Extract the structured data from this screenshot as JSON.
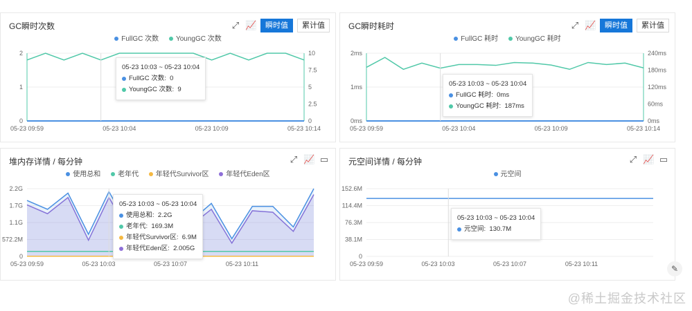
{
  "panels": {
    "gc_count": {
      "title": "GC瞬时次数",
      "btn_instant": "瞬时值",
      "btn_cumulative": "累计值",
      "legend": [
        {
          "label": "FullGC 次数",
          "color": "#4a90e2"
        },
        {
          "label": "YoungGC 次数",
          "color": "#50c8a8"
        }
      ],
      "tooltip": {
        "range": "05-23 10:03 ~ 05-23 10:04",
        "rows": [
          {
            "label": "FullGC 次数:",
            "value": "0",
            "color": "#4a90e2"
          },
          {
            "label": "YoungGC 次数:",
            "value": "9",
            "color": "#50c8a8"
          }
        ]
      }
    },
    "gc_time": {
      "title": "GC瞬时耗时",
      "btn_instant": "瞬时值",
      "btn_cumulative": "累计值",
      "legend": [
        {
          "label": "FullGC 耗时",
          "color": "#4a90e2"
        },
        {
          "label": "YoungGC 耗时",
          "color": "#50c8a8"
        }
      ],
      "tooltip": {
        "range": "05-23 10:03 ~ 05-23 10:04",
        "rows": [
          {
            "label": "FullGC 耗时:",
            "value": "0ms",
            "color": "#4a90e2"
          },
          {
            "label": "YoungGC 耗时:",
            "value": "187ms",
            "color": "#50c8a8"
          }
        ]
      }
    },
    "heap": {
      "title": "堆内存详情 / 每分钟",
      "legend": [
        {
          "label": "使用总和",
          "color": "#4a90e2"
        },
        {
          "label": "老年代",
          "color": "#50c8a8"
        },
        {
          "label": "年轻代Survivor区",
          "color": "#f5b942"
        },
        {
          "label": "年轻代Eden区",
          "color": "#8e6fd8"
        }
      ],
      "tooltip": {
        "range": "05-23 10:03 ~ 05-23 10:04",
        "rows": [
          {
            "label": "使用总和:",
            "value": "2.2G",
            "color": "#4a90e2"
          },
          {
            "label": "老年代:",
            "value": "169.3M",
            "color": "#50c8a8"
          },
          {
            "label": "年轻代Survivor区:",
            "value": "6.9M",
            "color": "#f5b942"
          },
          {
            "label": "年轻代Eden区:",
            "value": "2.005G",
            "color": "#8e6fd8"
          }
        ]
      }
    },
    "meta": {
      "title": "元空间详情 / 每分钟",
      "legend": [
        {
          "label": "元空间",
          "color": "#4a90e2"
        }
      ],
      "tooltip": {
        "range": "05-23 10:03 ~ 05-23 10:04",
        "rows": [
          {
            "label": "元空间:",
            "value": "130.7M",
            "color": "#4a90e2"
          }
        ]
      }
    }
  },
  "icons": {
    "expand": "expand-icon",
    "line_chart": "line-chart-icon",
    "table": "table-icon",
    "edit": "edit-icon"
  },
  "brand": "@稀土掘金技术社区",
  "chart_data": [
    {
      "type": "line",
      "title": "GC瞬时次数",
      "x_ticks": [
        "05-23 09:59",
        "05-23 10:04",
        "05-23 10:09",
        "05-23 10:14"
      ],
      "y_left_ticks": [
        "0",
        "1",
        "2"
      ],
      "y_right_ticks": [
        "0",
        "2.5",
        "5",
        "7.5",
        "10"
      ],
      "ylim_left": [
        0,
        2
      ],
      "ylim_right": [
        0,
        10
      ],
      "series": [
        {
          "name": "FullGC 次数",
          "axis": "left",
          "values": [
            0,
            0,
            0,
            0,
            0,
            0,
            0,
            0,
            0,
            0,
            0,
            0,
            0,
            0,
            0,
            0
          ]
        },
        {
          "name": "YoungGC 次数",
          "axis": "right",
          "values": [
            9,
            10,
            9,
            10,
            9,
            10,
            10,
            10,
            10,
            10,
            9,
            10,
            9,
            10,
            10,
            9
          ]
        }
      ]
    },
    {
      "type": "line",
      "title": "GC瞬时耗时",
      "x_ticks": [
        "05-23 09:59",
        "05-23 10:04",
        "05-23 10:09",
        "05-23 10:14"
      ],
      "y_left_ticks": [
        "0ms",
        "1ms",
        "2ms"
      ],
      "y_right_ticks": [
        "0ms",
        "60ms",
        "120ms",
        "180ms",
        "240ms"
      ],
      "ylim_left": [
        0,
        2
      ],
      "ylim_right": [
        0,
        240
      ],
      "series": [
        {
          "name": "FullGC 耗时",
          "axis": "left",
          "values": [
            0,
            0,
            0,
            0,
            0,
            0,
            0,
            0,
            0,
            0,
            0,
            0,
            0,
            0,
            0,
            0
          ]
        },
        {
          "name": "YoungGC 耗时",
          "axis": "right",
          "values": [
            190,
            225,
            183,
            205,
            187,
            200,
            200,
            197,
            207,
            205,
            198,
            183,
            207,
            200,
            205,
            188
          ]
        }
      ]
    },
    {
      "type": "area",
      "title": "堆内存详情 / 每分钟",
      "x_ticks": [
        "05-23 09:59",
        "05-23 10:03",
        "05-23 10:07",
        "05-23 10:11"
      ],
      "y_ticks": [
        "0",
        "572.2M",
        "1.1G",
        "1.7G",
        "2.2G"
      ],
      "ylim": [
        0,
        2.3
      ],
      "series": [
        {
          "name": "使用总和",
          "values": [
            1.9,
            1.6,
            2.15,
            0.75,
            2.2,
            0.95,
            1.5,
            1.9,
            1.2,
            1.8,
            0.6,
            1.7,
            1.7,
            1.0,
            2.3
          ]
        },
        {
          "name": "老年代",
          "values": [
            0.17,
            0.17,
            0.17,
            0.17,
            0.17,
            0.17,
            0.17,
            0.17,
            0.17,
            0.17,
            0.17,
            0.17,
            0.17,
            0.17,
            0.17
          ]
        },
        {
          "name": "年轻代Survivor区",
          "values": [
            0.007,
            0.007,
            0.007,
            0.007,
            0.007,
            0.007,
            0.007,
            0.007,
            0.007,
            0.007,
            0.007,
            0.007,
            0.007,
            0.007,
            0.007
          ]
        },
        {
          "name": "年轻代Eden区",
          "values": [
            1.75,
            1.45,
            2.0,
            0.55,
            2.0,
            0.8,
            1.35,
            1.7,
            1.05,
            1.6,
            0.45,
            1.55,
            1.5,
            0.85,
            2.1
          ]
        }
      ]
    },
    {
      "type": "line",
      "title": "元空间详情 / 每分钟",
      "x_ticks": [
        "05-23 09:59",
        "05-23 10:03",
        "05-23 10:07",
        "05-23 10:11"
      ],
      "y_ticks": [
        "0",
        "38.1M",
        "76.3M",
        "114.4M",
        "152.6M"
      ],
      "ylim": [
        0,
        152.6
      ],
      "series": [
        {
          "name": "元空间",
          "values": [
            130.7,
            130.7,
            130.7,
            130.7,
            130.7,
            130.7,
            130.7,
            130.7,
            130.7,
            130.7,
            130.7,
            130.7,
            130.7,
            130.7,
            130.7
          ]
        }
      ]
    }
  ]
}
